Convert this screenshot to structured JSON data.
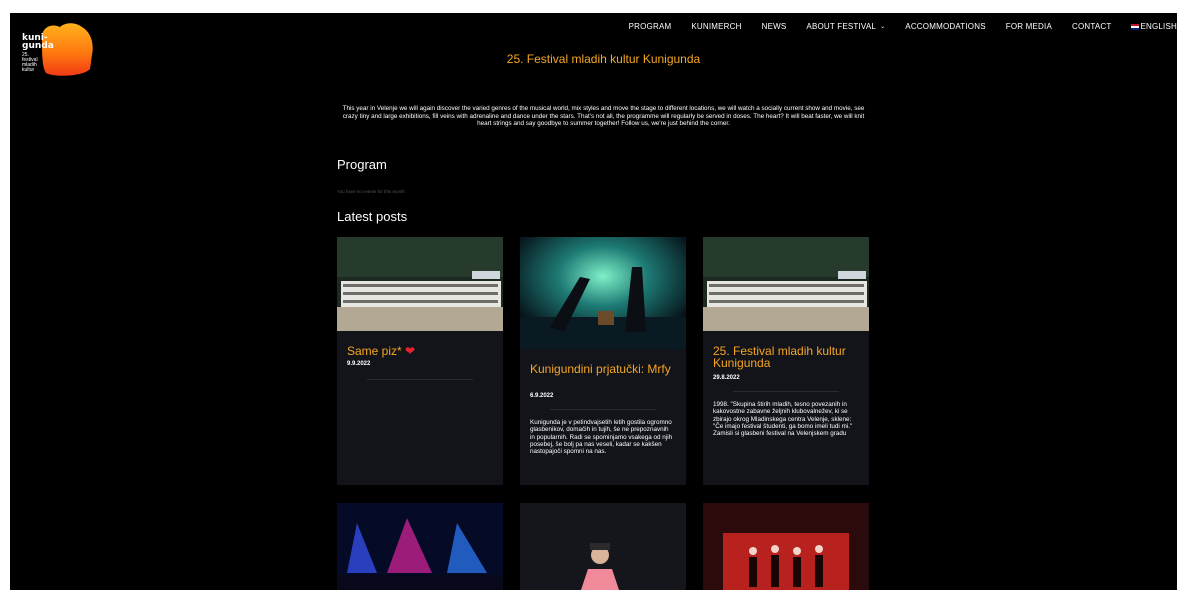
{
  "logo": {
    "top": "kuni-\ngunda",
    "sub": "25.\nfestival\nmladih\nkultur"
  },
  "nav": {
    "program": "PROGRAM",
    "kunimerch": "KUNIMERCH",
    "news": "NEWS",
    "about": "ABOUT FESTIVAL",
    "accommodations": "ACCOMMODATIONS",
    "media": "FOR MEDIA",
    "contact": "CONTACT",
    "language": "ENGLISH"
  },
  "page": {
    "title": "25. Festival mladih kultur Kunigunda",
    "intro": "This year in Velenje we will again discover the varied genres of the musical world, mix styles and move the stage to different locations, we will watch a socially current show and movie, see crazy tiny and large exhibitions, fill veins with adrenaline and dance under the stars. That's not all, the programme will regularly be served in doses. The heart? It will beat faster, we will knit heart strings and say goodbye to summer together! Follow us, we're just behind the corner.",
    "program_heading": "Program",
    "no_events": "You have no events for this month",
    "latest_heading": "Latest posts"
  },
  "posts": [
    {
      "title": "Same piz*",
      "date": "9.9.2022",
      "excerpt": ""
    },
    {
      "title": "Kunigundini prjatučki: Mrfy",
      "date": "6.9.2022",
      "excerpt": "Kunigunda je v petindvajsetih letih gostila ogromno glasbenikov, domačih in tujih, še ne prepoznavnih in popularnih. Radi se spominjamo vsakega od njih posebej, še bolj pa nas veseli, kadar se kakšen nastopajoči spomni na nas."
    },
    {
      "title": "25. Festival mladih kultur Kunigunda",
      "date": "29.8.2022",
      "excerpt": "1998. \"Skupina štirih mladih, tesno povezanih in kakovostne zabavne željnih klubovalnežev, ki se zbirajo okrog Mladinskega centra Velenje, sklene: \"Če imajo festival študenti, ga bomo imeli tudi mi.\" Zamisli si glasbeni festival na Velenjskem gradu"
    }
  ],
  "colors": {
    "accent": "#f5a623",
    "background": "#000000",
    "card": "#131419"
  }
}
